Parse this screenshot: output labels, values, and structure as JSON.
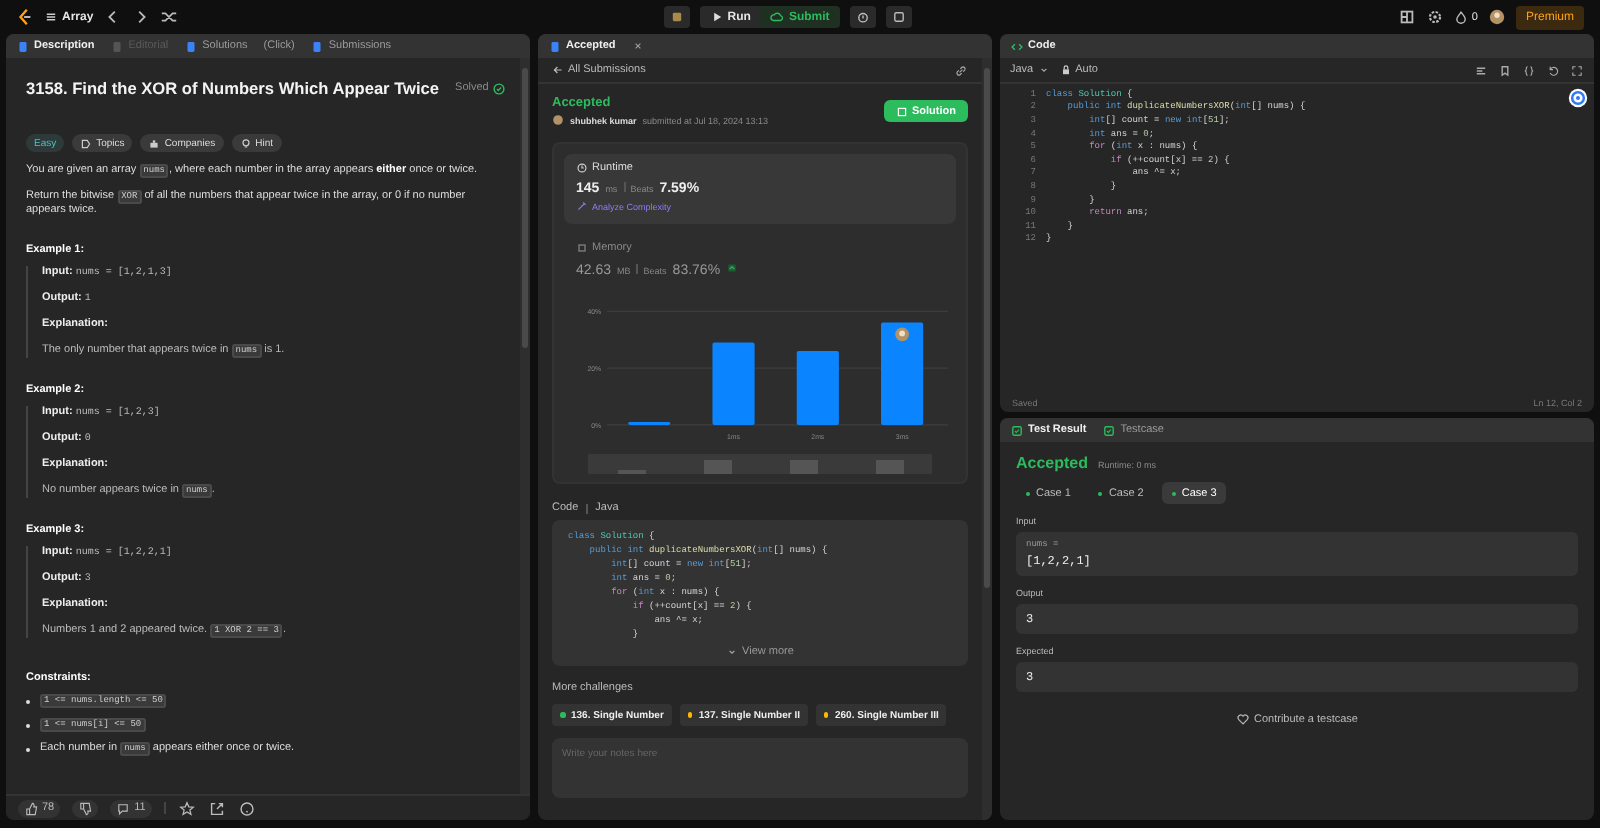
{
  "topbar": {
    "problem_list": "Array",
    "run": "Run",
    "submit": "Submit",
    "streak": "0",
    "premium": "Premium"
  },
  "description_panel": {
    "tabs": [
      {
        "label": "Description",
        "selected": true,
        "disabled": false,
        "icon": true
      },
      {
        "label": "Editorial",
        "selected": false,
        "disabled": true,
        "icon": true
      },
      {
        "label": "Solutions",
        "selected": false,
        "disabled": false,
        "icon": true
      },
      {
        "label": "(Click)",
        "selected": false,
        "disabled": false,
        "icon": false
      },
      {
        "label": "Submissions",
        "selected": false,
        "disabled": false,
        "icon": true
      }
    ],
    "title": "3158. Find the XOR of Numbers Which Appear Twice",
    "status": "Solved",
    "tags": [
      {
        "label": "Easy",
        "kind": "difficulty"
      },
      {
        "label": "Topics",
        "kind": "topics"
      },
      {
        "label": "Companies",
        "kind": "companies"
      },
      {
        "label": "Hint",
        "kind": "hint"
      }
    ],
    "paragraphs": [
      [
        {
          "kind": "text",
          "text": "You are given an array "
        },
        {
          "kind": "code",
          "text": "nums"
        },
        {
          "kind": "text",
          "text": ", where each number in the array appears "
        },
        {
          "kind": "bold",
          "text": "either"
        },
        {
          "kind": "text",
          "text": " once or twice."
        }
      ],
      [
        {
          "kind": "text",
          "text": "Return the bitwise "
        },
        {
          "kind": "code",
          "text": "XOR"
        },
        {
          "kind": "text",
          "text": " of all the numbers that appear twice in the array, or 0 if no number appears twice."
        }
      ]
    ],
    "examples": [
      {
        "title": "Example 1:",
        "input_label": "Input:",
        "input": "nums = [1,2,1,3]",
        "output_label": "Output:",
        "output": "1",
        "explanation_label": "Explanation:",
        "explanation": [
          {
            "kind": "text",
            "text": "The only number that appears twice in "
          },
          {
            "kind": "code",
            "text": "nums"
          },
          {
            "kind": "text",
            "text": " is 1."
          }
        ]
      },
      {
        "title": "Example 2:",
        "input_label": "Input:",
        "input": "nums = [1,2,3]",
        "output_label": "Output:",
        "output": "0",
        "explanation_label": "Explanation:",
        "explanation": [
          {
            "kind": "text",
            "text": "No number appears twice in "
          },
          {
            "kind": "code",
            "text": "nums"
          },
          {
            "kind": "text",
            "text": "."
          }
        ]
      },
      {
        "title": "Example 3:",
        "input_label": "Input:",
        "input": "nums = [1,2,2,1]",
        "output_label": "Output:",
        "output": "3",
        "explanation_label": "Explanation:",
        "explanation": [
          {
            "kind": "text",
            "text": "Numbers 1 and 2 appeared twice. "
          },
          {
            "kind": "code",
            "text": "1 XOR 2 == 3"
          },
          {
            "kind": "text",
            "text": "."
          }
        ]
      }
    ],
    "constraints_title": "Constraints:",
    "constraints": [
      [
        {
          "kind": "code",
          "text": "1 <= nums.length <= 50"
        }
      ],
      [
        {
          "kind": "code",
          "text": "1 <= nums[i] <= 50"
        }
      ],
      [
        {
          "kind": "text",
          "text": "Each number in "
        },
        {
          "kind": "code",
          "text": "nums"
        },
        {
          "kind": "text",
          "text": " appears either once or twice."
        }
      ]
    ],
    "footer": {
      "likes": "78",
      "comments": "11"
    }
  },
  "submission_panel": {
    "tab": "Accepted",
    "back_link": "All Submissions",
    "status": "Accepted",
    "user": "shubhek kumar",
    "submitted": "submitted at Jul 18, 2024 13:13",
    "solution_button": "Solution",
    "runtime": {
      "label": "Runtime",
      "value": "145",
      "unit": "ms",
      "beats_label": "Beats",
      "beats": "7.59%",
      "analyze": "Analyze Complexity"
    },
    "memory": {
      "label": "Memory",
      "value": "42.63",
      "unit": "MB",
      "beats_label": "Beats",
      "beats": "83.76%"
    },
    "chart_data": {
      "type": "bar",
      "categories": [
        null,
        "1ms",
        "2ms",
        "3ms"
      ],
      "values": [
        1,
        29,
        26,
        36
      ],
      "ylim": [
        0,
        40
      ],
      "yticks": [
        {
          "value": 0,
          "label": "0%"
        },
        {
          "value": 20,
          "label": "20%"
        },
        {
          "value": 40,
          "label": "40%"
        }
      ]
    },
    "code_label": "Code",
    "code_language": "Java",
    "code": [
      [
        {
          "kind": "kw",
          "text": "class "
        },
        {
          "kind": "type",
          "text": "Solution"
        },
        {
          "kind": "p",
          "text": " {"
        }
      ],
      [
        {
          "kind": "kw",
          "text": "    public int "
        },
        {
          "kind": "fn",
          "text": "duplicateNumbersXOR"
        },
        {
          "kind": "p",
          "text": "("
        },
        {
          "kind": "kw",
          "text": "int"
        },
        {
          "kind": "p",
          "text": "[] nums) {"
        }
      ],
      [
        {
          "kind": "kw",
          "text": "        int"
        },
        {
          "kind": "p",
          "text": "[] count = "
        },
        {
          "kind": "kw",
          "text": "new int"
        },
        {
          "kind": "p",
          "text": "["
        },
        {
          "kind": "num",
          "text": "51"
        },
        {
          "kind": "p",
          "text": "];"
        }
      ],
      [
        {
          "kind": "kw",
          "text": "        int"
        },
        {
          "kind": "p",
          "text": " ans = "
        },
        {
          "kind": "num",
          "text": "0"
        },
        {
          "kind": "p",
          "text": ";"
        }
      ],
      [
        {
          "kind": "ctl",
          "text": "        for"
        },
        {
          "kind": "p",
          "text": " ("
        },
        {
          "kind": "kw",
          "text": "int"
        },
        {
          "kind": "p",
          "text": " x : nums) {"
        }
      ],
      [
        {
          "kind": "ctl",
          "text": "            if"
        },
        {
          "kind": "p",
          "text": " (++count[x] == "
        },
        {
          "kind": "num",
          "text": "2"
        },
        {
          "kind": "p",
          "text": ") {"
        }
      ],
      [
        {
          "kind": "p",
          "text": "                ans ^= x;"
        }
      ],
      [
        {
          "kind": "p",
          "text": "            }"
        }
      ]
    ],
    "view_more": "View more",
    "more_title": "More challenges",
    "challenges": [
      {
        "label": "136. Single Number",
        "color": "#2cbb5d"
      },
      {
        "label": "137. Single Number II",
        "color": "#ffb800"
      },
      {
        "label": "260. Single Number III",
        "color": "#ffb800"
      }
    ],
    "notes": {
      "placeholder": "Write your notes here"
    }
  },
  "editor": {
    "tab": "Code",
    "language": "Java",
    "mode": "Auto",
    "lines": [
      {
        "no": "1",
        "tokens": [
          {
            "kind": "kw",
            "text": "class "
          },
          {
            "kind": "type",
            "text": "Solution"
          },
          {
            "kind": "p",
            "text": " {"
          }
        ]
      },
      {
        "no": "2",
        "tokens": [
          {
            "kind": "kw",
            "text": "    public int "
          },
          {
            "kind": "fn",
            "text": "duplicateNumbersXOR"
          },
          {
            "kind": "p",
            "text": "("
          },
          {
            "kind": "kw",
            "text": "int"
          },
          {
            "kind": "p",
            "text": "[] nums) {"
          }
        ]
      },
      {
        "no": "3",
        "tokens": [
          {
            "kind": "kw",
            "text": "        int"
          },
          {
            "kind": "p",
            "text": "[] count = "
          },
          {
            "kind": "kw",
            "text": "new int"
          },
          {
            "kind": "p",
            "text": "["
          },
          {
            "kind": "num",
            "text": "51"
          },
          {
            "kind": "p",
            "text": "];"
          }
        ]
      },
      {
        "no": "4",
        "tokens": [
          {
            "kind": "kw",
            "text": "        int"
          },
          {
            "kind": "p",
            "text": " ans = "
          },
          {
            "kind": "num",
            "text": "0"
          },
          {
            "kind": "p",
            "text": ";"
          }
        ]
      },
      {
        "no": "5",
        "tokens": [
          {
            "kind": "ctl",
            "text": "        for"
          },
          {
            "kind": "p",
            "text": " ("
          },
          {
            "kind": "kw",
            "text": "int"
          },
          {
            "kind": "p",
            "text": " x : nums) {"
          }
        ]
      },
      {
        "no": "6",
        "tokens": [
          {
            "kind": "ctl",
            "text": "            if"
          },
          {
            "kind": "p",
            "text": " (++count[x] == "
          },
          {
            "kind": "num",
            "text": "2"
          },
          {
            "kind": "p",
            "text": ") {"
          }
        ]
      },
      {
        "no": "7",
        "tokens": [
          {
            "kind": "p",
            "text": "                ans ^= x;"
          }
        ]
      },
      {
        "no": "8",
        "tokens": [
          {
            "kind": "p",
            "text": "            }"
          }
        ]
      },
      {
        "no": "9",
        "tokens": [
          {
            "kind": "p",
            "text": "        }"
          }
        ]
      },
      {
        "no": "10",
        "tokens": [
          {
            "kind": "ctl",
            "text": "        return"
          },
          {
            "kind": "p",
            "text": " ans;"
          }
        ]
      },
      {
        "no": "11",
        "tokens": [
          {
            "kind": "p",
            "text": "    }"
          }
        ]
      },
      {
        "no": "12",
        "tokens": [
          {
            "kind": "p",
            "text": "}"
          }
        ]
      }
    ],
    "saved": "Saved",
    "cursor": "Ln 12, Col 2"
  },
  "test_panel": {
    "tabs": [
      {
        "label": "Test Result",
        "selected": true
      },
      {
        "label": "Testcase",
        "selected": false
      }
    ],
    "verdict": "Accepted",
    "runtime": "Runtime: 0 ms",
    "cases": [
      {
        "label": "Case 1",
        "selected": false
      },
      {
        "label": "Case 2",
        "selected": false
      },
      {
        "label": "Case 3",
        "selected": true
      }
    ],
    "input_label": "Input",
    "input_name": "nums =",
    "input_value": "[1,2,2,1]",
    "output_label": "Output",
    "output": "3",
    "expected_label": "Expected",
    "expected": "3",
    "contribute": "Contribute a testcase"
  }
}
